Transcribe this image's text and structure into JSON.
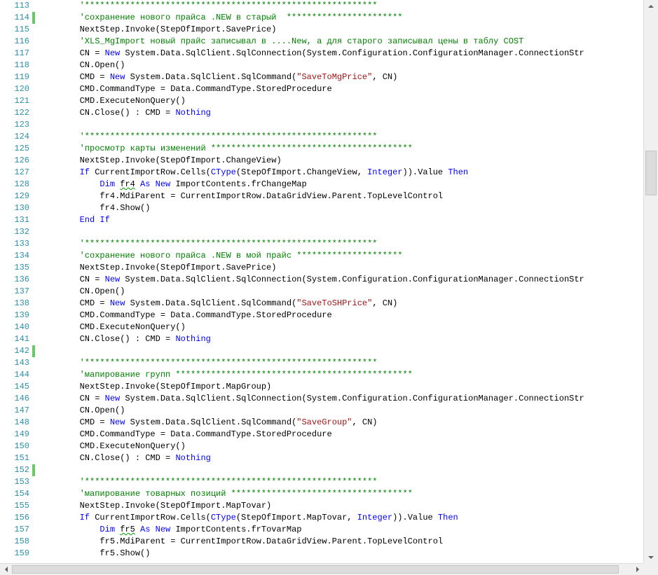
{
  "colors": {
    "line_number": "#2b91af",
    "keyword": "#0000ff",
    "comment": "#008000",
    "string": "#a31515",
    "text": "#000000",
    "change_marker": "#6cc76c"
  },
  "scroll": {
    "vertical_thumb_position": 0.28,
    "horizontal_thumb_position": 0.0
  },
  "lines": [
    {
      "n": "113",
      "changed": false,
      "segs": [
        {
          "t": "        "
        },
        {
          "t": "'**********************************************************",
          "c": "cm"
        }
      ]
    },
    {
      "n": "114",
      "changed": true,
      "segs": [
        {
          "t": "        "
        },
        {
          "t": "'сохранение нового прайса .NEW в старый  ***********************",
          "c": "cm"
        }
      ]
    },
    {
      "n": "115",
      "changed": false,
      "segs": [
        {
          "t": "        NextStep.Invoke(StepOfImport.SavePrice)"
        }
      ]
    },
    {
      "n": "116",
      "changed": false,
      "segs": [
        {
          "t": "        "
        },
        {
          "t": "'XLS_MgImport новый прайс записывал в ....New, а для старого записывал цены в таблу COST",
          "c": "cm"
        }
      ]
    },
    {
      "n": "117",
      "changed": false,
      "segs": [
        {
          "t": "        CN = "
        },
        {
          "t": "New",
          "c": "kw"
        },
        {
          "t": " System.Data.SqlClient.SqlConnection(System.Configuration.ConfigurationManager.ConnectionStr"
        }
      ]
    },
    {
      "n": "118",
      "changed": false,
      "segs": [
        {
          "t": "        CN.Open()"
        }
      ]
    },
    {
      "n": "119",
      "changed": false,
      "segs": [
        {
          "t": "        CMD = "
        },
        {
          "t": "New",
          "c": "kw"
        },
        {
          "t": " System.Data.SqlClient.SqlCommand("
        },
        {
          "t": "\"SaveToMgPrice\"",
          "c": "st"
        },
        {
          "t": ", CN)"
        }
      ]
    },
    {
      "n": "120",
      "changed": false,
      "segs": [
        {
          "t": "        CMD.CommandType = Data.CommandType.StoredProcedure"
        }
      ]
    },
    {
      "n": "121",
      "changed": false,
      "segs": [
        {
          "t": "        CMD.ExecuteNonQuery()"
        }
      ]
    },
    {
      "n": "122",
      "changed": false,
      "segs": [
        {
          "t": "        CN.Close() : CMD = "
        },
        {
          "t": "Nothing",
          "c": "kw"
        }
      ]
    },
    {
      "n": "123",
      "changed": false,
      "segs": [
        {
          "t": ""
        }
      ]
    },
    {
      "n": "124",
      "changed": false,
      "segs": [
        {
          "t": "        "
        },
        {
          "t": "'**********************************************************",
          "c": "cm"
        }
      ]
    },
    {
      "n": "125",
      "changed": false,
      "segs": [
        {
          "t": "        "
        },
        {
          "t": "'просмотр карты изменений ****************************************",
          "c": "cm"
        }
      ]
    },
    {
      "n": "126",
      "changed": false,
      "segs": [
        {
          "t": "        NextStep.Invoke(StepOfImport.ChangeView)"
        }
      ]
    },
    {
      "n": "127",
      "changed": false,
      "segs": [
        {
          "t": "        "
        },
        {
          "t": "If",
          "c": "kw"
        },
        {
          "t": " CurrentImportRow.Cells("
        },
        {
          "t": "CType",
          "c": "kw"
        },
        {
          "t": "(StepOfImport.ChangeView, "
        },
        {
          "t": "Integer",
          "c": "kw"
        },
        {
          "t": ")).Value "
        },
        {
          "t": "Then",
          "c": "kw"
        }
      ]
    },
    {
      "n": "128",
      "changed": false,
      "segs": [
        {
          "t": "            "
        },
        {
          "t": "Dim",
          "c": "kw"
        },
        {
          "t": " "
        },
        {
          "t": "fr4",
          "u": true
        },
        {
          "t": " "
        },
        {
          "t": "As New",
          "c": "kw"
        },
        {
          "t": " ImportContents.frChangeMap"
        }
      ]
    },
    {
      "n": "129",
      "changed": false,
      "segs": [
        {
          "t": "            fr4.MdiParent = CurrentImportRow.DataGridView.Parent.TopLevelControl"
        }
      ]
    },
    {
      "n": "130",
      "changed": false,
      "segs": [
        {
          "t": "            fr4.Show()"
        }
      ]
    },
    {
      "n": "131",
      "changed": false,
      "segs": [
        {
          "t": "        "
        },
        {
          "t": "End If",
          "c": "kw"
        }
      ]
    },
    {
      "n": "132",
      "changed": false,
      "segs": [
        {
          "t": ""
        }
      ]
    },
    {
      "n": "133",
      "changed": false,
      "segs": [
        {
          "t": "        "
        },
        {
          "t": "'**********************************************************",
          "c": "cm"
        }
      ]
    },
    {
      "n": "134",
      "changed": false,
      "segs": [
        {
          "t": "        "
        },
        {
          "t": "'сохранение нового прайса .NEW в мой прайс *********************",
          "c": "cm"
        }
      ]
    },
    {
      "n": "135",
      "changed": false,
      "segs": [
        {
          "t": "        NextStep.Invoke(StepOfImport.SavePrice)"
        }
      ]
    },
    {
      "n": "136",
      "changed": false,
      "segs": [
        {
          "t": "        CN = "
        },
        {
          "t": "New",
          "c": "kw"
        },
        {
          "t": " System.Data.SqlClient.SqlConnection(System.Configuration.ConfigurationManager.ConnectionStr"
        }
      ]
    },
    {
      "n": "137",
      "changed": false,
      "segs": [
        {
          "t": "        CN.Open()"
        }
      ]
    },
    {
      "n": "138",
      "changed": false,
      "segs": [
        {
          "t": "        CMD = "
        },
        {
          "t": "New",
          "c": "kw"
        },
        {
          "t": " System.Data.SqlClient.SqlCommand("
        },
        {
          "t": "\"SaveToSHPrice\"",
          "c": "st"
        },
        {
          "t": ", CN)"
        }
      ]
    },
    {
      "n": "139",
      "changed": false,
      "segs": [
        {
          "t": "        CMD.CommandType = Data.CommandType.StoredProcedure"
        }
      ]
    },
    {
      "n": "140",
      "changed": false,
      "segs": [
        {
          "t": "        CMD.ExecuteNonQuery()"
        }
      ]
    },
    {
      "n": "141",
      "changed": false,
      "segs": [
        {
          "t": "        CN.Close() : CMD = "
        },
        {
          "t": "Nothing",
          "c": "kw"
        }
      ]
    },
    {
      "n": "142",
      "changed": true,
      "segs": [
        {
          "t": ""
        }
      ]
    },
    {
      "n": "143",
      "changed": false,
      "segs": [
        {
          "t": "        "
        },
        {
          "t": "'**********************************************************",
          "c": "cm"
        }
      ]
    },
    {
      "n": "144",
      "changed": false,
      "segs": [
        {
          "t": "        "
        },
        {
          "t": "'мапирование групп ***********************************************",
          "c": "cm"
        }
      ]
    },
    {
      "n": "145",
      "changed": false,
      "segs": [
        {
          "t": "        NextStep.Invoke(StepOfImport.MapGroup)"
        }
      ]
    },
    {
      "n": "146",
      "changed": false,
      "segs": [
        {
          "t": "        CN = "
        },
        {
          "t": "New",
          "c": "kw"
        },
        {
          "t": " System.Data.SqlClient.SqlConnection(System.Configuration.ConfigurationManager.ConnectionStr"
        }
      ]
    },
    {
      "n": "147",
      "changed": false,
      "segs": [
        {
          "t": "        CN.Open()"
        }
      ]
    },
    {
      "n": "148",
      "changed": false,
      "segs": [
        {
          "t": "        CMD = "
        },
        {
          "t": "New",
          "c": "kw"
        },
        {
          "t": " System.Data.SqlClient.SqlCommand("
        },
        {
          "t": "\"SaveGroup\"",
          "c": "st"
        },
        {
          "t": ", CN)"
        }
      ]
    },
    {
      "n": "149",
      "changed": false,
      "segs": [
        {
          "t": "        CMD.CommandType = Data.CommandType.StoredProcedure"
        }
      ]
    },
    {
      "n": "150",
      "changed": false,
      "segs": [
        {
          "t": "        CMD.ExecuteNonQuery()"
        }
      ]
    },
    {
      "n": "151",
      "changed": false,
      "segs": [
        {
          "t": "        CN.Close() : CMD = "
        },
        {
          "t": "Nothing",
          "c": "kw"
        }
      ]
    },
    {
      "n": "152",
      "changed": true,
      "segs": [
        {
          "t": ""
        }
      ]
    },
    {
      "n": "153",
      "changed": false,
      "segs": [
        {
          "t": "        "
        },
        {
          "t": "'**********************************************************",
          "c": "cm"
        }
      ]
    },
    {
      "n": "154",
      "changed": false,
      "segs": [
        {
          "t": "        "
        },
        {
          "t": "'мапирование товарных позиций ************************************",
          "c": "cm"
        }
      ]
    },
    {
      "n": "155",
      "changed": false,
      "segs": [
        {
          "t": "        NextStep.Invoke(StepOfImport.MapTovar)"
        }
      ]
    },
    {
      "n": "156",
      "changed": false,
      "segs": [
        {
          "t": "        "
        },
        {
          "t": "If",
          "c": "kw"
        },
        {
          "t": " CurrentImportRow.Cells("
        },
        {
          "t": "CType",
          "c": "kw"
        },
        {
          "t": "(StepOfImport.MapTovar, "
        },
        {
          "t": "Integer",
          "c": "kw"
        },
        {
          "t": ")).Value "
        },
        {
          "t": "Then",
          "c": "kw"
        }
      ]
    },
    {
      "n": "157",
      "changed": false,
      "segs": [
        {
          "t": "            "
        },
        {
          "t": "Dim",
          "c": "kw"
        },
        {
          "t": " "
        },
        {
          "t": "fr5",
          "u": true
        },
        {
          "t": " "
        },
        {
          "t": "As New",
          "c": "kw"
        },
        {
          "t": " ImportContents.frTovarMap"
        }
      ]
    },
    {
      "n": "158",
      "changed": false,
      "segs": [
        {
          "t": "            fr5.MdiParent = CurrentImportRow.DataGridView.Parent.TopLevelControl"
        }
      ]
    },
    {
      "n": "159",
      "changed": false,
      "segs": [
        {
          "t": "            fr5.Show()"
        }
      ]
    }
  ]
}
